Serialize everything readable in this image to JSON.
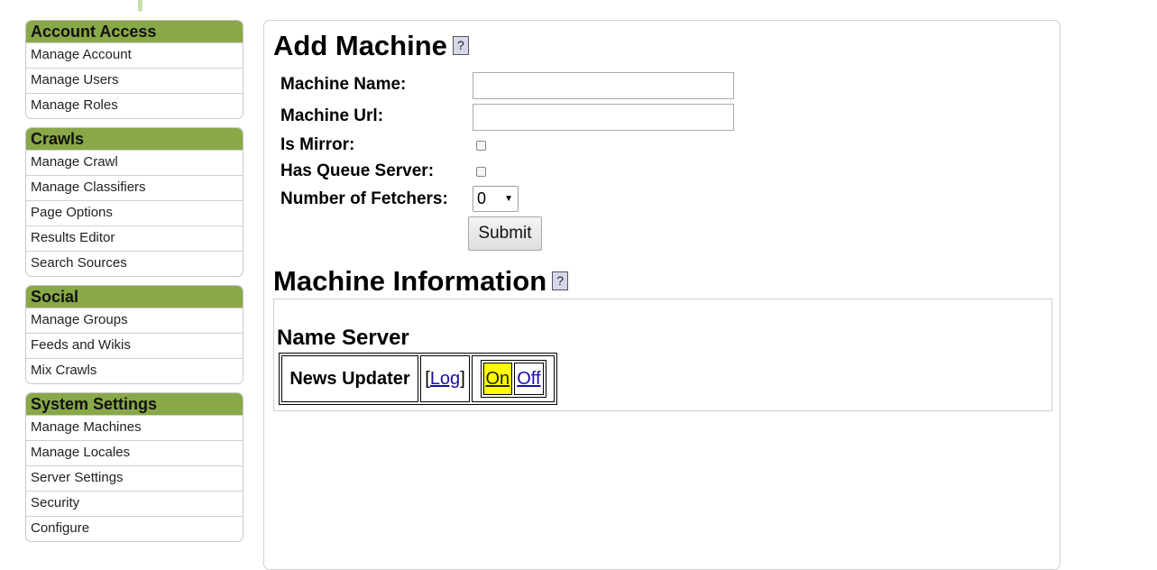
{
  "sidebar": {
    "groups": [
      {
        "title": "Account Access",
        "items": [
          "Manage Account",
          "Manage Users",
          "Manage Roles"
        ]
      },
      {
        "title": "Crawls",
        "items": [
          "Manage Crawl",
          "Manage Classifiers",
          "Page Options",
          "Results Editor",
          "Search Sources"
        ]
      },
      {
        "title": "Social",
        "items": [
          "Manage Groups",
          "Feeds and Wikis",
          "Mix Crawls"
        ]
      },
      {
        "title": "System Settings",
        "items": [
          "Manage Machines",
          "Manage Locales",
          "Server Settings",
          "Security",
          "Configure"
        ]
      }
    ],
    "header_color": "#89a848"
  },
  "add_machine": {
    "title": "Add Machine",
    "help": "?",
    "machine_name_label": "Machine Name:",
    "machine_name_value": "",
    "machine_url_label": "Machine Url:",
    "machine_url_value": "",
    "is_mirror_label": "Is Mirror:",
    "is_mirror_checked": false,
    "has_queue_server_label": "Has Queue Server:",
    "has_queue_server_checked": false,
    "num_fetchers_label": "Number of Fetchers:",
    "num_fetchers_value": "0",
    "submit_label": "Submit"
  },
  "machine_info": {
    "title": "Machine Information",
    "help": "?",
    "server_name": "Name Server",
    "process_name": "News Updater",
    "log_open": "[",
    "log_label": "Log",
    "log_close": "]",
    "on_label": "On",
    "off_label": "Off",
    "active_state": "On",
    "active_color": "#ffff00"
  }
}
